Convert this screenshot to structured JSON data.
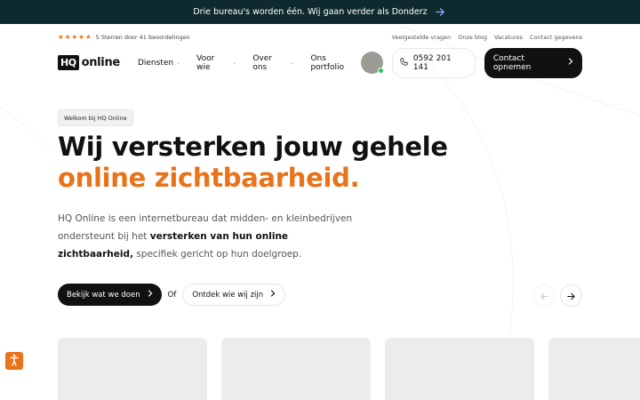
{
  "announcement": {
    "text": "Drie bureau's worden één. Wij gaan verder als Donderz",
    "arrow_icon": "arrow-right-icon"
  },
  "utility": {
    "stars": 5,
    "rating_text": "5 Sterren door 41 beoordelingen",
    "links": [
      "Veelgestelde vragen",
      "Onze blog",
      "Vacatures",
      "Contact gegevens"
    ]
  },
  "nav": {
    "logo_mark": "HQ",
    "logo_text": "online",
    "items": [
      {
        "label": "Diensten",
        "has_dropdown": true
      },
      {
        "label": "Voor wie",
        "has_dropdown": true
      },
      {
        "label": "Over ons",
        "has_dropdown": true
      },
      {
        "label": "Ons portfolio",
        "has_dropdown": false
      }
    ],
    "phone": "0592 201 141",
    "contact_label": "Contact opnemen"
  },
  "hero": {
    "badge": "Welkom bij HQ Online",
    "title_line1": "Wij versterken jouw gehele",
    "title_line2": "online zichtbaarheid.",
    "lead_part1": "HQ Online is een internetbureau dat midden- en kleinbedrijven ondersteunt bij het ",
    "lead_bold": "versterken van hun online zichtbaarheid,",
    "lead_part2": " specifiek gericht op hun doelgroep.",
    "cta_primary": "Bekijk wat we doen",
    "cta_or": "Of",
    "cta_secondary": "Ontdek wie wij zijn"
  },
  "colors": {
    "accent": "#e8731a",
    "dark": "#111111",
    "announce_bg": "#0f2a2e",
    "card_bg": "#ececec",
    "online": "#22c55e"
  },
  "icons": {
    "phone": "phone-icon",
    "chevron": "chevron-right-icon",
    "prev": "arrow-left-icon",
    "next": "arrow-right-icon",
    "accessibility": "accessibility-icon"
  }
}
